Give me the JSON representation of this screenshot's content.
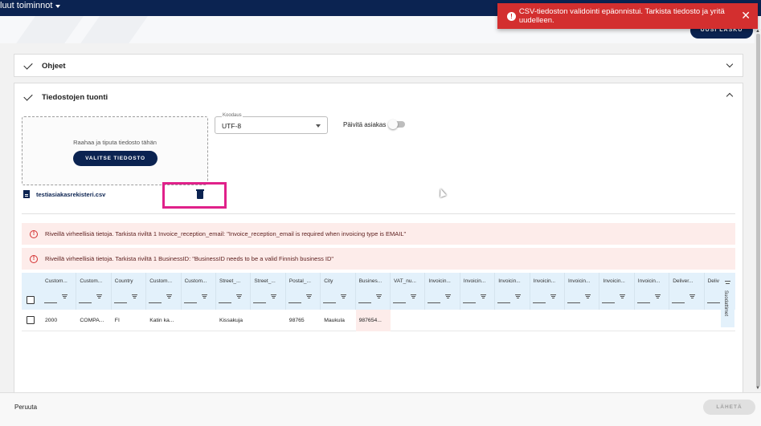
{
  "topbar": {
    "menu_label": "luut toiminnot"
  },
  "header": {
    "new_button_label": "UUSI LASKU"
  },
  "toast": {
    "message": "CSV-tiedoston validointi epäonnistui. Tarkista tiedosto ja yritä uudelleen.",
    "close_symbol": "✕",
    "color": "#d32f2f"
  },
  "panels": {
    "ohjeet": {
      "title": "Ohjeet"
    },
    "tuonti": {
      "title": "Tiedostojen tuonti"
    }
  },
  "dropzone": {
    "text": "Raahaa ja tiputa tiedosto tähän",
    "button_label": "VALITSE TIEDOSTO"
  },
  "file": {
    "name": "testiasiakasrekisteri.csv"
  },
  "encoding": {
    "label": "Koodaus",
    "value": "UTF-8"
  },
  "update_customer": {
    "label": "Päivitä asiakas",
    "enabled": false
  },
  "alerts": [
    {
      "text": "Riveillä virheellisiä tietoja. Tarkista riviltä 1 Invoice_reception_email: \"Invoice_reception_email is required when invoicing type is EMAIL\""
    },
    {
      "text": "Riveillä virheellisiä tietoja. Tarkista riviltä 1 BusinessID: \"BusinessID needs to be a valid Finnish business ID\""
    }
  ],
  "grid": {
    "columns": [
      "Custom...",
      "Custom...",
      "Country",
      "Custom...",
      "Custom...",
      "Street_...",
      "Street_...",
      "Postal_...",
      "City",
      "Busines...",
      "VAT_nu...",
      "Invoicin...",
      "Invoicin...",
      "Invoicin...",
      "Invoicin...",
      "Invoicin...",
      "Invoicin...",
      "Invoicin...",
      "Deliver...",
      "Deliv"
    ],
    "rows": [
      {
        "cells": [
          "2000",
          "COMPA...",
          "FI",
          "Katin ka...",
          "",
          "Kissakuja",
          "",
          "98765",
          "Maukula",
          "987654...",
          "",
          "",
          "",
          "",
          "",
          "",
          "",
          "",
          "",
          ""
        ]
      }
    ],
    "error_column_index": 9,
    "side_panel_label": "Suodattimet"
  },
  "footer": {
    "cancel_label": "Peruuta",
    "send_label": "LÄHETÄ"
  },
  "colors": {
    "brand_navy": "#0b2351",
    "highlight_pink": "#e0218a",
    "grid_header_bg": "#e3f1fb",
    "error_bg": "#fdecea"
  }
}
